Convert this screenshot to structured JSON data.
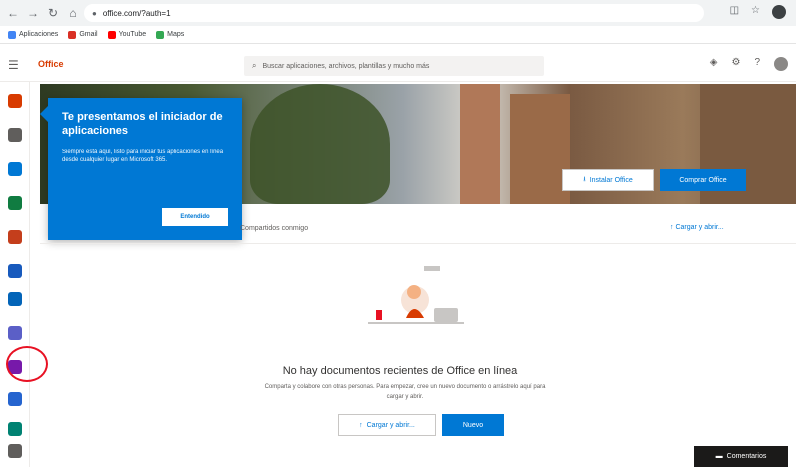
{
  "browser": {
    "url": "office.com/?auth=1",
    "back_icon": "back-arrow-icon",
    "forward_icon": "forward-arrow-icon",
    "reload_icon": "reload-icon",
    "home_icon": "home-icon"
  },
  "bookmarks": [
    {
      "label": "Aplicaciones",
      "color": "#4285f4"
    },
    {
      "label": "Gmail",
      "color": "#d93025"
    },
    {
      "label": "YouTube",
      "color": "#ff0000"
    },
    {
      "label": "Maps",
      "color": "#34a853"
    }
  ],
  "header": {
    "brand": "Office",
    "search_placeholder": "Buscar aplicaciones, archivos, plantillas y mucho más"
  },
  "hero": {
    "install_label": "Instalar Office",
    "buy_label": "Comprar Office"
  },
  "callout": {
    "title": "Te presentamos el iniciador de aplicaciones",
    "body": "Siempre está aquí, listo para iniciar tus aplicaciones en línea desde cualquier lugar en Microsoft 365.",
    "button": "Entendido"
  },
  "recent": {
    "shared_label": "Compartidos conmigo",
    "upload_label": "Cargar y abrir...",
    "empty_title": "No hay documentos recientes de Office en línea",
    "empty_subtitle": "Comparta y colabore con otras personas. Para empezar, cree un nuevo documento o arrástrelo aquí para cargar y abrir.",
    "upload_button": "Cargar y abrir...",
    "new_button": "Nuevo"
  },
  "feedback": {
    "label": "Comentarios"
  },
  "rail": [
    {
      "name": "home",
      "color": "#d83b01"
    },
    {
      "name": "create",
      "color": "#605e5c"
    },
    {
      "name": "outlook",
      "color": "#0078d4"
    },
    {
      "name": "excel",
      "color": "#107c41"
    },
    {
      "name": "powerpoint",
      "color": "#c43e1c"
    },
    {
      "name": "word",
      "color": "#185abd"
    },
    {
      "name": "onedrive",
      "color": "#0364b8"
    },
    {
      "name": "teams",
      "color": "#5b5fc7"
    },
    {
      "name": "onenote",
      "color": "#7719aa"
    },
    {
      "name": "todo",
      "color": "#2564cf"
    },
    {
      "name": "sway",
      "color": "#008272"
    },
    {
      "name": "all-apps",
      "color": "#605e5c"
    }
  ]
}
